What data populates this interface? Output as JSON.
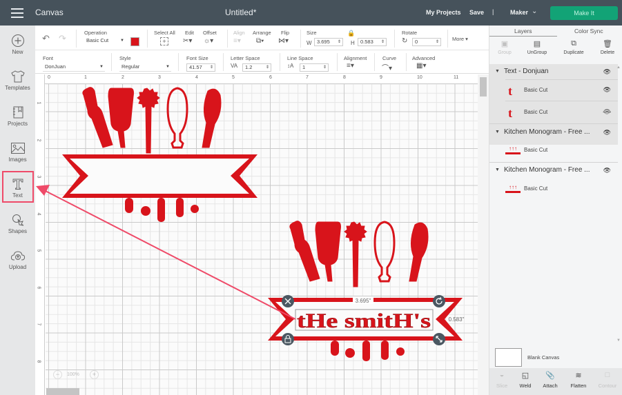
{
  "topbar": {
    "app_title": "Canvas",
    "doc_title": "Untitled*",
    "my_projects": "My Projects",
    "save": "Save",
    "separator": "|",
    "machine": "Maker",
    "make_it": "Make It",
    "make_it_color": "#12a376"
  },
  "sidebar": {
    "items": [
      {
        "label": "New",
        "icon": "plus-circle-icon"
      },
      {
        "label": "Templates",
        "icon": "shirt-icon"
      },
      {
        "label": "Projects",
        "icon": "notebook-icon"
      },
      {
        "label": "Images",
        "icon": "image-icon"
      },
      {
        "label": "Text",
        "icon": "text-t-icon",
        "highlighted": true
      },
      {
        "label": "Shapes",
        "icon": "shapes-icon"
      },
      {
        "label": "Upload",
        "icon": "cloud-upload-icon"
      }
    ]
  },
  "toolbar1": {
    "undo": "undo-icon",
    "redo": "redo-icon",
    "operation_label": "Operation",
    "operation_value": "Basic Cut",
    "color": "#d8141b",
    "select_all": "Select All",
    "edit": "Edit",
    "offset": "Offset",
    "align": "Align",
    "arrange": "Arrange",
    "flip": "Flip",
    "size_label": "Size",
    "w_label": "W",
    "w_value": "3.695",
    "h_label": "H",
    "h_value": "0.583",
    "rotate_label": "Rotate",
    "rotate_value": "0",
    "more": "More"
  },
  "toolbar2": {
    "font_label": "Font",
    "font_value": "DonJuan",
    "style_label": "Style",
    "style_value": "Regular",
    "font_size_label": "Font Size",
    "font_size_value": "41.57",
    "letter_space_label": "Letter Space",
    "letter_space_value": "1.2",
    "line_space_label": "Line Space",
    "line_space_value": "1",
    "alignment_label": "Alignment",
    "curve_label": "Curve",
    "advanced_label": "Advanced"
  },
  "ruler": {
    "top": [
      "0",
      "1",
      "2",
      "3",
      "4",
      "5",
      "6",
      "7",
      "8",
      "9",
      "10",
      "11"
    ],
    "left": [
      "1",
      "2",
      "3",
      "4",
      "5",
      "6",
      "7",
      "8"
    ]
  },
  "canvas": {
    "zoom_level": "100%",
    "text_content": "tHe smitH's",
    "width_readout": "3.695\"",
    "height_readout": "0.583\"",
    "design_color": "#d8141b"
  },
  "panel": {
    "tabs": [
      "Layers",
      "Color Sync"
    ],
    "tools": [
      {
        "label": "Group",
        "enabled": false
      },
      {
        "label": "UnGroup",
        "enabled": true
      },
      {
        "label": "Duplicate",
        "enabled": true
      },
      {
        "label": "Delete",
        "enabled": true
      }
    ],
    "groups": [
      {
        "name": "Text - Donjuan",
        "layers": [
          {
            "name": "Basic Cut",
            "visible": true
          },
          {
            "name": "Basic Cut",
            "visible": false
          }
        ]
      },
      {
        "name": "Kitchen Monogram - Free ...",
        "layers": [
          {
            "name": "Basic Cut",
            "visible": true
          }
        ]
      },
      {
        "name": "Kitchen Monogram - Free ...",
        "layers": [
          {
            "name": "Basic Cut",
            "visible": true
          }
        ]
      }
    ],
    "blank_canvas": "Blank Canvas",
    "bottom_tools": [
      {
        "label": "Slice",
        "enabled": false
      },
      {
        "label": "Weld",
        "enabled": true
      },
      {
        "label": "Attach",
        "enabled": true
      },
      {
        "label": "Flatten",
        "enabled": true
      },
      {
        "label": "Contour",
        "enabled": false
      }
    ]
  }
}
